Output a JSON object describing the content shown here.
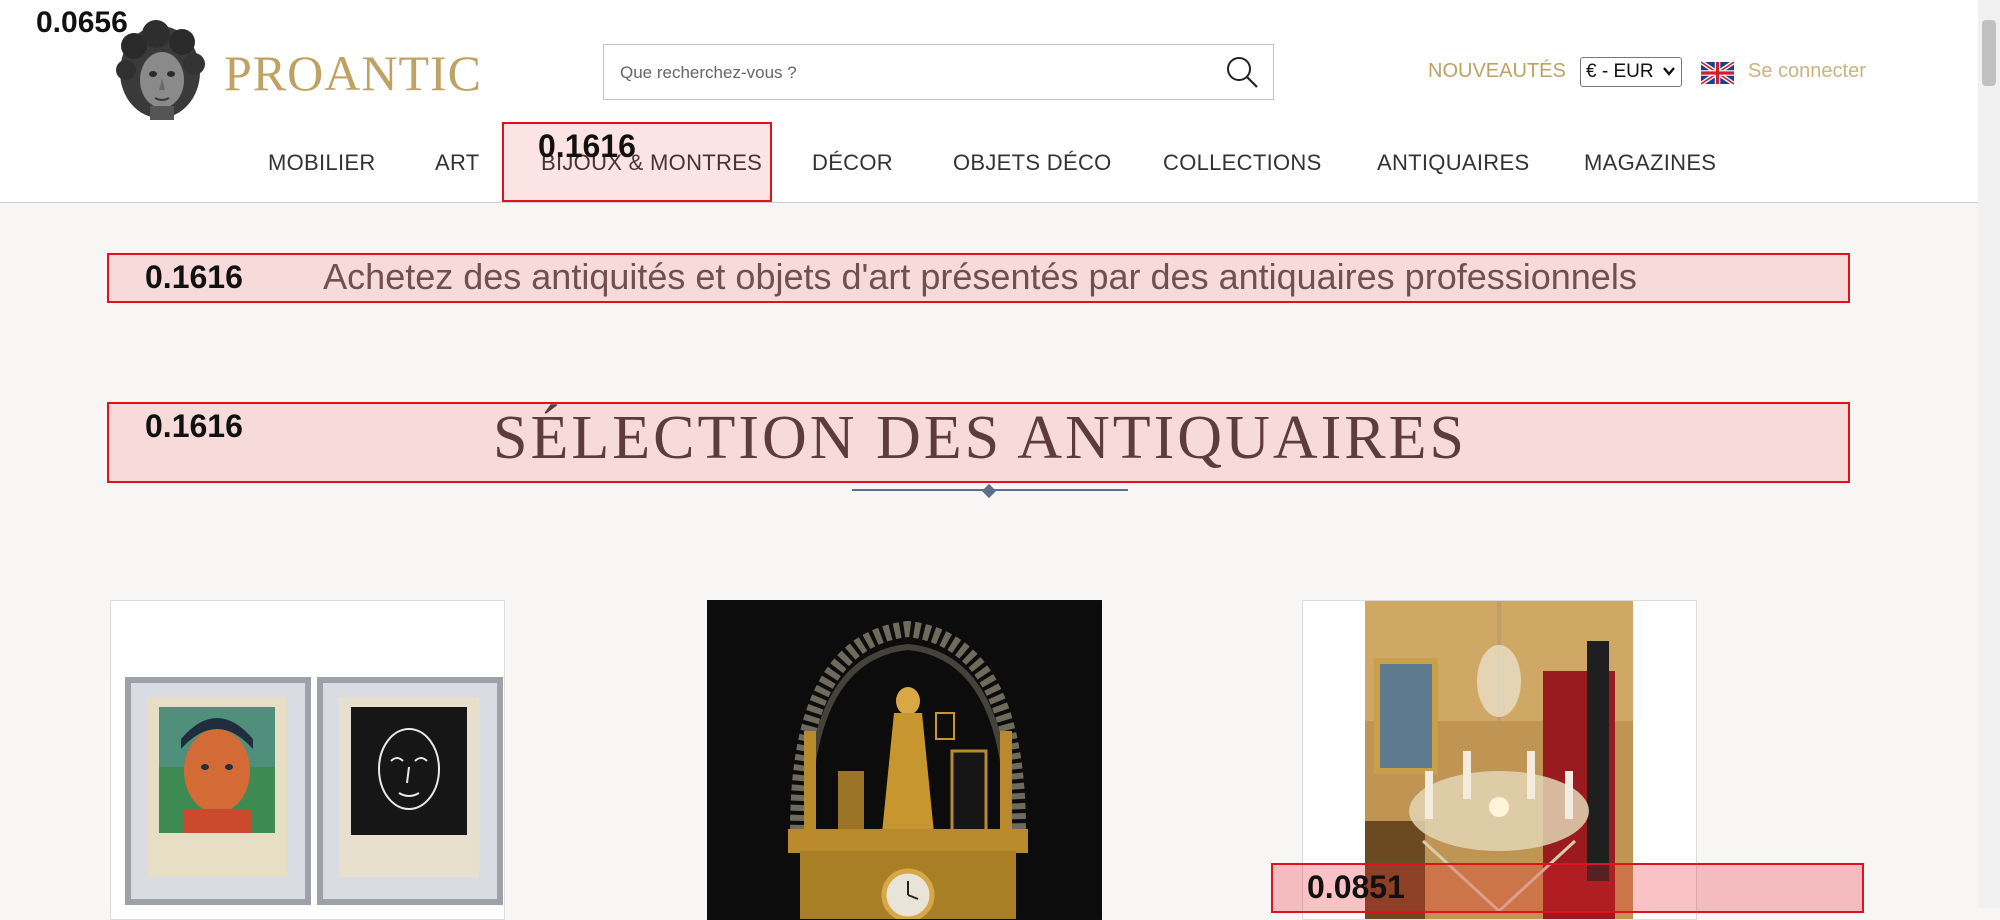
{
  "header": {
    "logo_text": "PROANTIC",
    "search": {
      "placeholder": "Que recherchez-vous ?",
      "value": ""
    },
    "nouveautes_label": "NOUVEAUTÉS",
    "currency_selected": "€ - EUR",
    "login_label": "Se connecter"
  },
  "nav": {
    "items": [
      {
        "label": "MOBILIER"
      },
      {
        "label": "ART"
      },
      {
        "label": "BIJOUX & MONTRES"
      },
      {
        "label": "DÉCOR"
      },
      {
        "label": "OBJETS DÉCO"
      },
      {
        "label": "COLLECTIONS"
      },
      {
        "label": "ANTIQUAIRES"
      },
      {
        "label": "MAGAZINES"
      }
    ]
  },
  "main": {
    "tagline": "Achetez des antiquités et objets d'art présentés par des antiquaires professionnels",
    "section_title": "SÉLECTION DES ANTIQUAIRES"
  },
  "overlays": {
    "corner_score": "0.0656",
    "nav_score": "0.1616",
    "tagline_score": "0.1616",
    "title_score": "0.1616",
    "card_score": "0.0851"
  },
  "colors": {
    "brand_gold": "#bfa163",
    "overlay_red": "#e0131c",
    "accent_blue": "#5b6f89"
  }
}
